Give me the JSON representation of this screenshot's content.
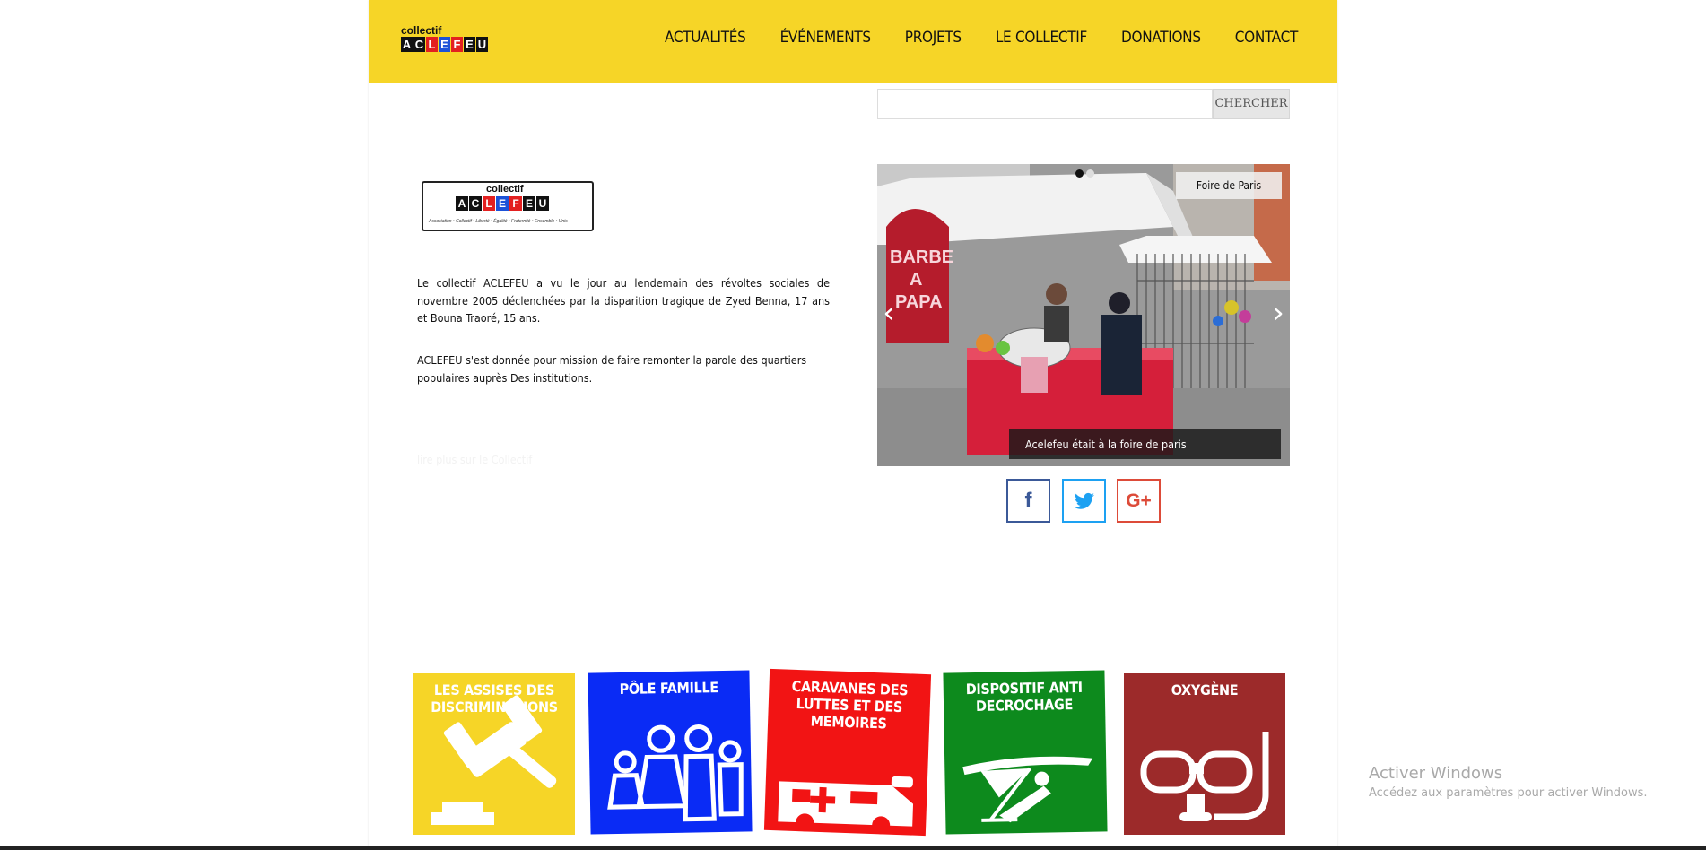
{
  "brand": {
    "top_word": "collectif",
    "tiles": [
      "A",
      "C",
      "L",
      "E",
      "F",
      "E",
      "U"
    ],
    "tile_colors": [
      "#111111",
      "#111111",
      "#e32020",
      "#1c52d8",
      "#e32020",
      "#111111",
      "#111111"
    ],
    "motto": "Association • Collectif • Liberté • Égalité • Fraternité • Ensemble • Unis"
  },
  "nav": {
    "items": [
      "ACTUALITÉS",
      "ÉVÉNEMENTS",
      "PROJETS",
      "LE COLLECTIF",
      "DONATIONS",
      "CONTACT"
    ]
  },
  "search": {
    "value": "",
    "placeholder": "",
    "button_label": "CHERCHER"
  },
  "intro": {
    "paragraph1": "Le collectif ACLEFEU a vu le jour au lendemain des révoltes sociales de novembre 2005 déclenchées par la disparition tragique de Zyed Benna, 17 ans et Bouna Traoré, 15 ans.",
    "paragraph2": "ACLEFEU s'est donnée pour mission de faire remonter la parole des quartiers populaires auprès Des institutions.",
    "read_more": "lire plus sur le Collectif"
  },
  "slider": {
    "tag": "Foire de Paris",
    "caption": "Acelefeu était à la foire de paris",
    "sign_text": "BARBE A PAPA",
    "slides_count": 2,
    "active_slide": 1
  },
  "social": {
    "facebook_icon": "f",
    "twitter_icon": "🐦",
    "googleplus_icon": "G+"
  },
  "tiles": [
    {
      "label": "LES ASSISES DES DISCRIMINATIONS",
      "icon": "gavel-icon",
      "color": "#f6d527"
    },
    {
      "label": "PÔLE FAMILLE",
      "icon": "family-icon",
      "color": "#0a2bf5"
    },
    {
      "label": "CARAVANES DES LUTTES ET DES MEMOIRES",
      "icon": "caravan-icon",
      "color": "#f21414"
    },
    {
      "label": "DISPOSITIF ANTI DECROCHAGE",
      "icon": "hang-glider-icon",
      "color": "#0d8a1d"
    },
    {
      "label": "OXYGÈNE",
      "icon": "snorkel-mask-icon",
      "color": "#9c2a2a"
    }
  ],
  "windows_watermark": {
    "title": "Activer Windows",
    "subtitle": "Accédez aux paramètres pour activer Windows."
  }
}
